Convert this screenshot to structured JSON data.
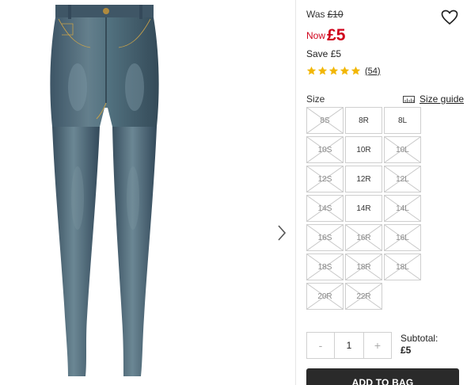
{
  "pricing": {
    "was_label": "Was",
    "was_price": "£10",
    "now_label": "Now",
    "now_price": "£5",
    "save_label": "Save",
    "save_amount": "£5",
    "accent_color": "#d0021b"
  },
  "rating": {
    "stars": 5,
    "count": "(54)"
  },
  "sizes": {
    "label": "Size",
    "guide_label": "Size guide",
    "options": [
      {
        "label": "8S",
        "available": false
      },
      {
        "label": "8R",
        "available": true
      },
      {
        "label": "8L",
        "available": true
      },
      {
        "label": "10S",
        "available": false
      },
      {
        "label": "10R",
        "available": true
      },
      {
        "label": "10L",
        "available": false
      },
      {
        "label": "12S",
        "available": false
      },
      {
        "label": "12R",
        "available": true
      },
      {
        "label": "12L",
        "available": false
      },
      {
        "label": "14S",
        "available": false
      },
      {
        "label": "14R",
        "available": true
      },
      {
        "label": "14L",
        "available": false
      },
      {
        "label": "16S",
        "available": false
      },
      {
        "label": "16R",
        "available": false
      },
      {
        "label": "16L",
        "available": false
      },
      {
        "label": "18S",
        "available": false
      },
      {
        "label": "18R",
        "available": false
      },
      {
        "label": "18L",
        "available": false
      },
      {
        "label": "20R",
        "available": false
      },
      {
        "label": "22R",
        "available": false
      }
    ]
  },
  "quantity": {
    "minus": "-",
    "value": "1",
    "plus": "+"
  },
  "subtotal": {
    "label": "Subtotal:",
    "amount": "£5"
  },
  "cart": {
    "add_label": "ADD TO BAG"
  },
  "icons": {
    "wishlist": "heart-icon",
    "next": "chevron-right-icon",
    "star": "star-icon",
    "size_guide": "ruler-icon"
  }
}
